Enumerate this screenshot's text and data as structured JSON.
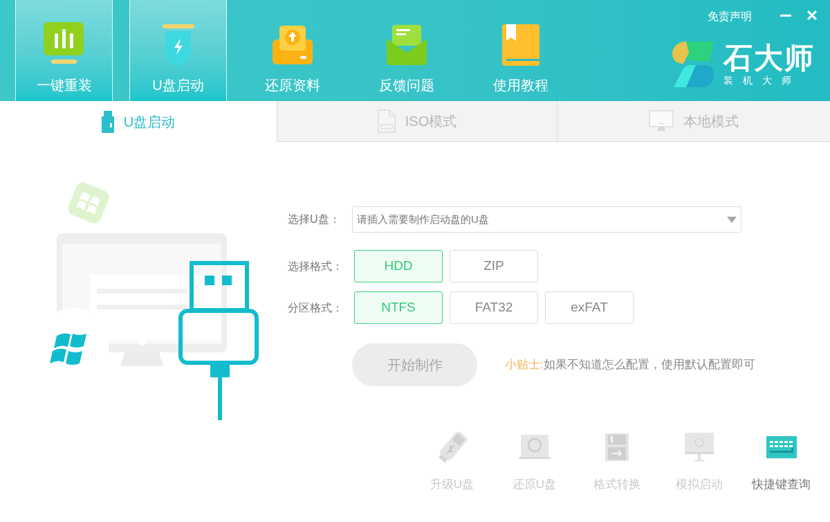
{
  "header": {
    "nav": [
      {
        "label": "一键重装",
        "kind": "chart",
        "highlighted": true
      },
      {
        "label": "U盘启动",
        "kind": "usb",
        "highlighted": true
      },
      {
        "label": "还原资料",
        "kind": "restore",
        "highlighted": false
      },
      {
        "label": "反馈问题",
        "kind": "mail",
        "highlighted": false
      },
      {
        "label": "使用教程",
        "kind": "book",
        "highlighted": false
      }
    ],
    "disclaimer": "免责声明",
    "logo": {
      "name": "石大师",
      "tagline": "装 机 大 师"
    }
  },
  "tabs": [
    {
      "label": "U盘启动",
      "kind": "usb",
      "selected": true
    },
    {
      "label": "ISO模式",
      "kind": "iso",
      "selected": false
    },
    {
      "label": "本地模式",
      "kind": "local",
      "selected": false
    }
  ],
  "form": {
    "drive_label": "选择U盘：",
    "drive_placeholder": "请插入需要制作启动盘的U盘",
    "format_label": "选择格式：",
    "formats": [
      {
        "label": "HDD",
        "selected": true
      },
      {
        "label": "ZIP",
        "selected": false
      }
    ],
    "partition_label": "分区格式：",
    "partitions": [
      {
        "label": "NTFS",
        "selected": true
      },
      {
        "label": "FAT32",
        "selected": false
      },
      {
        "label": "exFAT",
        "selected": false
      }
    ],
    "start_button": {
      "label": "开始制作",
      "disabled": true
    },
    "tip": {
      "prefix": "小贴士:",
      "text": "如果不知道怎么配置，使用默认配置即可"
    }
  },
  "tools": [
    {
      "label": "升级U盘",
      "kind": "usb",
      "disabled": true
    },
    {
      "label": "还原U盘",
      "kind": "laptop",
      "disabled": true
    },
    {
      "label": "格式转换",
      "kind": "floppy",
      "disabled": true
    },
    {
      "label": "模拟启动",
      "kind": "monitor",
      "disabled": true
    },
    {
      "label": "快捷键查询",
      "kind": "keyboard",
      "disabled": false
    }
  ]
}
